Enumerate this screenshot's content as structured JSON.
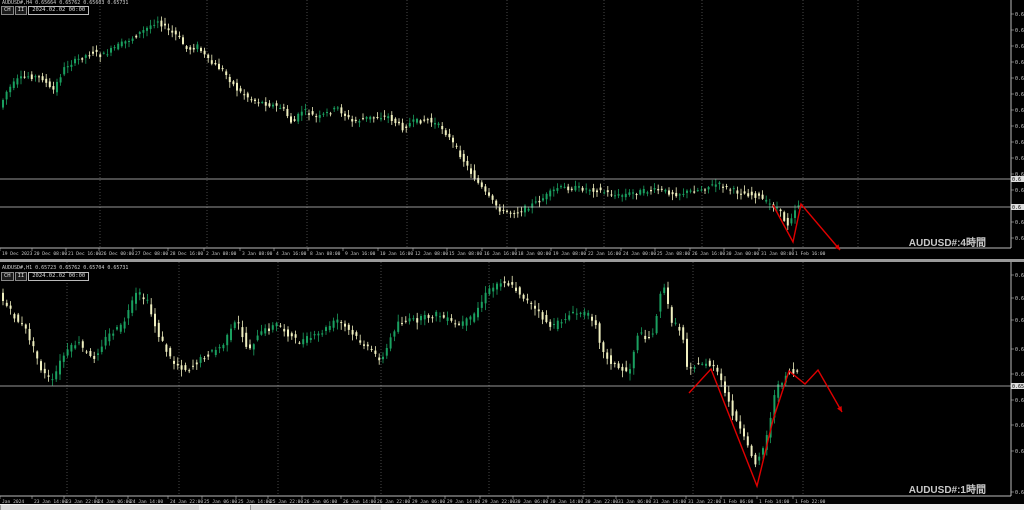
{
  "colors": {
    "bull": "#1aa060",
    "bear": "#f0f0c0",
    "arrow": "#e00000",
    "label": "#2aa0b0",
    "grid": "#5a5a5a",
    "priceline": "#c8c8c8"
  },
  "top": {
    "header": "AUDUSD#,H4  0.65664 0.65762 0.65603 0.65731",
    "btn1": "CH",
    "btn2": "II",
    "date": "2024.02.02 00:00",
    "label": "AUDUSD#:4時間",
    "price_ticks": [
      "0.6",
      "0.6",
      "0.6",
      "0.6",
      "0.6",
      "0.6",
      "0.6",
      "0.6",
      "0.6",
      "0.6",
      "0.6",
      "0.6",
      "0.6",
      "0.6"
    ],
    "highlight_ticks": [
      "0.6",
      "0.6"
    ],
    "time_ticks": [
      "19 Dec 2023",
      "20 Dec 08:00",
      "21 Dec 16:00",
      "26 Dec 00:00",
      "27 Dec 08:00",
      "28 Dec 16:00",
      "2 Jan 08:00",
      "3 Jan 08:00",
      "4 Jan 16:00",
      "8 Jan 08:00",
      "9 Jan 16:00",
      "10 Jan 16:00",
      "12 Jan 08:00",
      "15 Jan 08:00",
      "16 Jan 16:00",
      "18 Jan 00:00",
      "19 Jan 08:00",
      "22 Jan 16:00",
      "24 Jan 00:00",
      "25 Jan 08:00",
      "26 Jan 16:00",
      "30 Jan 00:00",
      "31 Jan 08:00",
      "1 Feb 16:00"
    ],
    "candle_bodies": [
      [
        "0",
        "0"
      ]
    ]
  },
  "bot": {
    "header": "AUDUSD#,H1  0.65723 0.65762 0.65704 0.65731",
    "btn1": "CH",
    "btn2": "II",
    "date": "2024.02.02 00:00",
    "label": "AUDUSD#:1時間",
    "price_ticks": [
      "0.66",
      "0.66",
      "0.66",
      "0.65",
      "0.65",
      "0.65",
      "0.65",
      "0.65",
      "0.65"
    ],
    "highlight_tick": "0.65",
    "time_ticks": [
      "Jan 2024",
      "23 Jan 14:00",
      "23 Jan 22:00",
      "24 Jan 06:00",
      "24 Jan 14:00",
      "24 Jan 22:00",
      "25 Jan 06:00",
      "25 Jan 14:00",
      "25 Jan 22:00",
      "26 Jan 06:00",
      "26 Jan 14:00",
      "26 Jan 22:00",
      "29 Jan 06:00",
      "29 Jan 14:00",
      "29 Jan 22:00",
      "30 Jan 06:00",
      "30 Jan 14:00",
      "30 Jan 22:00",
      "31 Jan 06:00",
      "31 Jan 14:00",
      "31 Jan 22:00",
      "1 Feb 06:00",
      "1 Feb 14:00",
      "1 Feb 22:00"
    ]
  }
}
